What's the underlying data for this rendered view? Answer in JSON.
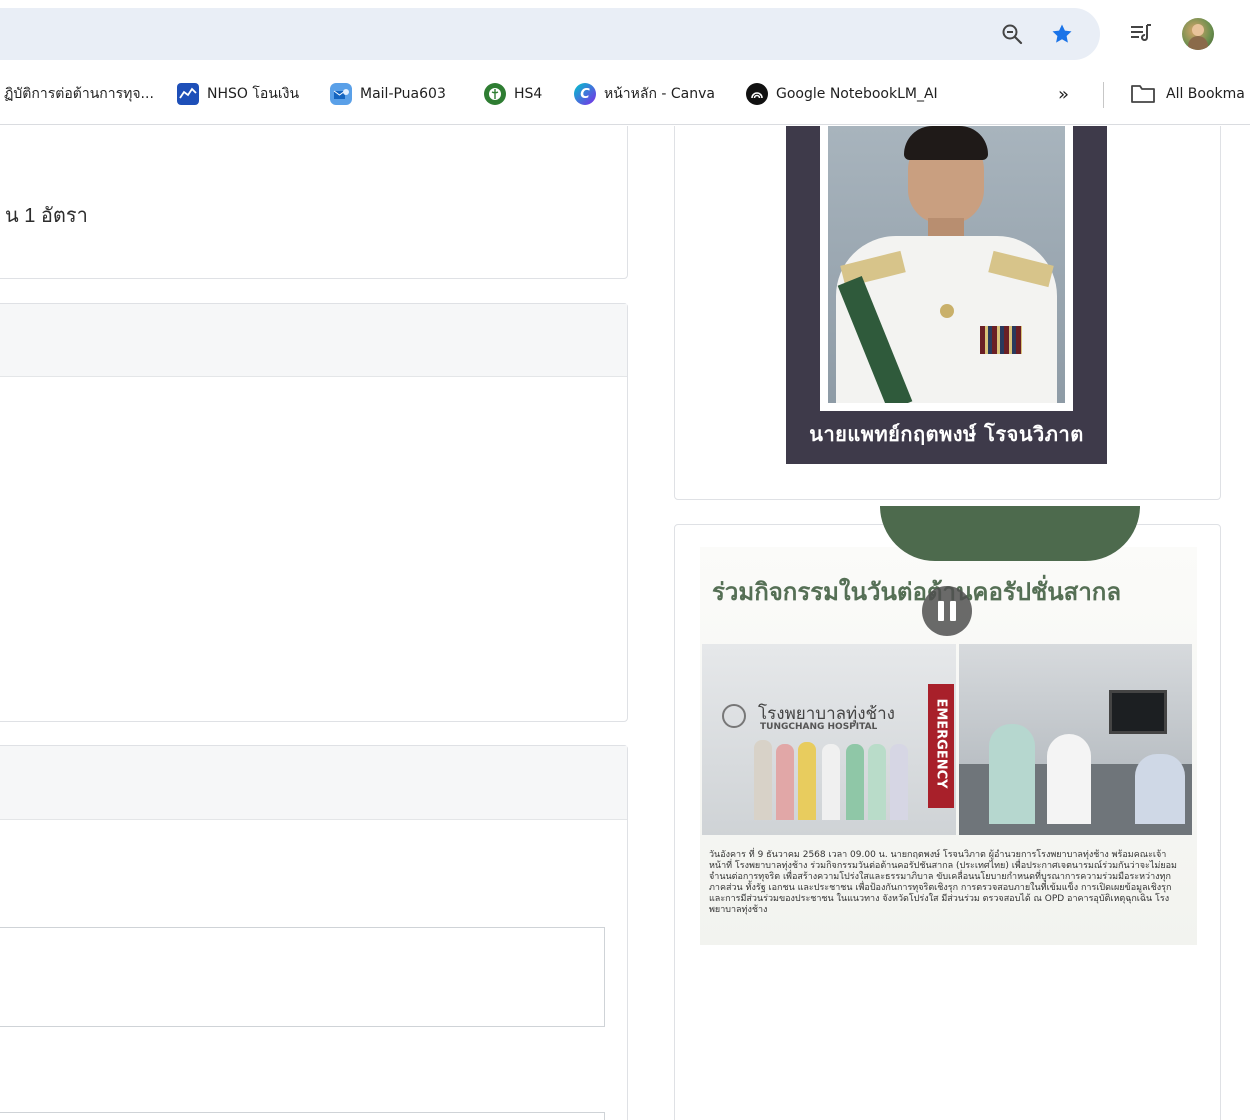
{
  "browser": {
    "bookmarks": [
      {
        "label": "ฏิบัติการต่อต้านการทุจ..."
      },
      {
        "label": "NHSO โอนเงิน"
      },
      {
        "label": "Mail-Pua603"
      },
      {
        "label": "HS4"
      },
      {
        "label": "หน้าหลัก - Canva"
      },
      {
        "label": "Google NotebookLM_AI"
      }
    ],
    "overflow_label": "»",
    "all_bookmarks_label": "All Bookma"
  },
  "colors": {
    "omnibox_bg": "#e9eef6",
    "star": "#1a73e8",
    "card_border": "#dfe1e5",
    "portrait_frame": "#3e3a4a",
    "event_title": "#556f55"
  },
  "main": {
    "rate_text": "น 1 อัตรา"
  },
  "sidebar": {
    "portrait_name": "นายแพทย์กฤตพงษ์  โรจนวิภาต",
    "event_title": "ร่วมกิจกรรมในวันต่อต้านคอรัปชั่นสากล",
    "hospital_sign": "โรงพยาบาลทุ่งช้าง",
    "hospital_sign_en": "TUNGCHANG HOSPITAL",
    "emergency_sign": "EMERGENCY",
    "event_description": "วันอังคาร ที่ 9 ธันวาคม 2568 เวลา 09.00 น. นายกฤตพงษ์ โรจนวิภาต ผู้อำนวยการโรงพยาบาลทุ่งช้าง พร้อมคณะเจ้าหน้าที่ โรงพยาบาลทุ่งช้าง ร่วมกิจกรรมวันต่อต้านคอรัปชันสากล (ประเทศไทย) เพื่อประกาศเจตนารมณ์ร่วมกันว่าจะไม่ยอมจำนนต่อการทุจริต เพื่อสร้างความโปร่งใสและธรรมาภิบาล ขับเคลื่อนนโยบายกำหนดที่บูรณาการความร่วมมือระหว่างทุกภาคส่วน ทั้งรัฐ เอกชน และประชาชน เพื่อป้องกันการทุจริตเชิงรุก การตรวจสอบภายในที่เข้มแข็ง การเปิดเผยข้อมูลเชิงรุก และการมีส่วนร่วมของประชาชน ในแนวทาง จังหวัดโปร่งใส มีส่วนร่วม ตรวจสอบได้ ณ OPD อาคารอุบัติเหตุฉุกเฉิน โรงพยาบาลทุ่งช้าง"
  }
}
